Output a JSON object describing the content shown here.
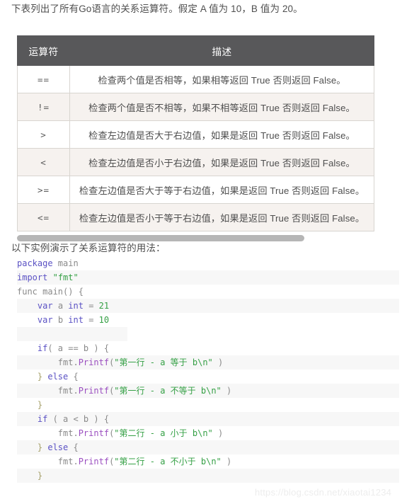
{
  "intro": {
    "text": "下表列出了所有Go语言的关系运算符。假定 A 值为 10，B 值为 20。"
  },
  "table": {
    "headers": {
      "operator": "运算符",
      "description": "描述"
    },
    "rows": [
      {
        "operator": "==",
        "description": "检查两个值是否相等，如果相等返回 True 否则返回 False。"
      },
      {
        "operator": "!=",
        "description": "检查两个值是否不相等，如果不相等返回 True 否则返回 False。"
      },
      {
        "operator": ">",
        "description": "检查左边值是否大于右边值，如果是返回 True 否则返回 False。"
      },
      {
        "operator": "<",
        "description": "检查左边值是否小于右边值，如果是返回 True 否则返回 False。"
      },
      {
        "operator": ">=",
        "description": "检查左边值是否大于等于右边值，如果是返回 True 否则返回 False。"
      },
      {
        "operator": "<=",
        "description": "检查左边值是否小于等于右边值，如果是返回 True 否则返回 False。"
      }
    ]
  },
  "scrollbar": {
    "orientation": "horizontal",
    "thumb_color": "#b6b6b6"
  },
  "example": {
    "text": "以下实例演示了关系运算符的用法："
  },
  "code": {
    "language": "go",
    "lines": [
      {
        "indent": 0,
        "tokens": [
          {
            "t": "package",
            "c": "kw"
          },
          {
            "t": " main",
            "c": "plain"
          }
        ]
      },
      {
        "indent": 0,
        "tokens": [
          {
            "t": "import",
            "c": "kw"
          },
          {
            "t": " ",
            "c": "plain"
          },
          {
            "t": "\"fmt\"",
            "c": "str"
          }
        ]
      },
      {
        "indent": 0,
        "tokens": [
          {
            "t": "func main() {",
            "c": "plain"
          }
        ]
      },
      {
        "indent": 1,
        "tokens": [
          {
            "t": "var",
            "c": "kw"
          },
          {
            "t": " a ",
            "c": "plain"
          },
          {
            "t": "int",
            "c": "kw"
          },
          {
            "t": " = ",
            "c": "plain"
          },
          {
            "t": "21",
            "c": "num"
          }
        ]
      },
      {
        "indent": 1,
        "tokens": [
          {
            "t": "var",
            "c": "kw"
          },
          {
            "t": " b ",
            "c": "plain"
          },
          {
            "t": "int",
            "c": "kw"
          },
          {
            "t": " = ",
            "c": "plain"
          },
          {
            "t": "10",
            "c": "num"
          }
        ]
      },
      {
        "indent": 0,
        "tokens": []
      },
      {
        "indent": 1,
        "tokens": [
          {
            "t": "if",
            "c": "kw"
          },
          {
            "t": "( a == b ) {",
            "c": "plain"
          }
        ]
      },
      {
        "indent": 2,
        "tokens": [
          {
            "t": "fmt.",
            "c": "plain"
          },
          {
            "t": "Printf",
            "c": "fn"
          },
          {
            "t": "(",
            "c": "plain"
          },
          {
            "t": "\"第一行 - a 等于 b\\n\"",
            "c": "str"
          },
          {
            "t": " )",
            "c": "plain"
          }
        ]
      },
      {
        "indent": 1,
        "tokens": [
          {
            "t": "} ",
            "c": "punc"
          },
          {
            "t": "else",
            "c": "kw"
          },
          {
            "t": " {",
            "c": "plain"
          }
        ]
      },
      {
        "indent": 2,
        "tokens": [
          {
            "t": "fmt.",
            "c": "plain"
          },
          {
            "t": "Printf",
            "c": "fn"
          },
          {
            "t": "(",
            "c": "plain"
          },
          {
            "t": "\"第一行 - a 不等于 b\\n\"",
            "c": "str"
          },
          {
            "t": " )",
            "c": "plain"
          }
        ]
      },
      {
        "indent": 1,
        "tokens": [
          {
            "t": "}",
            "c": "punc"
          }
        ]
      },
      {
        "indent": 1,
        "tokens": [
          {
            "t": "if",
            "c": "kw"
          },
          {
            "t": " ( a < b ) {",
            "c": "plain"
          }
        ]
      },
      {
        "indent": 2,
        "tokens": [
          {
            "t": "fmt.",
            "c": "plain"
          },
          {
            "t": "Printf",
            "c": "fn"
          },
          {
            "t": "(",
            "c": "plain"
          },
          {
            "t": "\"第二行 - a 小于 b\\n\"",
            "c": "str"
          },
          {
            "t": " )",
            "c": "plain"
          }
        ]
      },
      {
        "indent": 1,
        "tokens": [
          {
            "t": "} ",
            "c": "punc"
          },
          {
            "t": "else",
            "c": "kw"
          },
          {
            "t": " {",
            "c": "plain"
          }
        ]
      },
      {
        "indent": 2,
        "tokens": [
          {
            "t": "fmt.",
            "c": "plain"
          },
          {
            "t": "Printf",
            "c": "fn"
          },
          {
            "t": "(",
            "c": "plain"
          },
          {
            "t": "\"第二行 - a 不小于 b\\n\"",
            "c": "str"
          },
          {
            "t": " )",
            "c": "plain"
          }
        ]
      },
      {
        "indent": 1,
        "tokens": [
          {
            "t": "}",
            "c": "punc"
          }
        ]
      },
      {
        "indent": 0,
        "tokens": []
      }
    ]
  },
  "watermark": {
    "text": "https://blog.csdn.net/xiaotai1234"
  }
}
